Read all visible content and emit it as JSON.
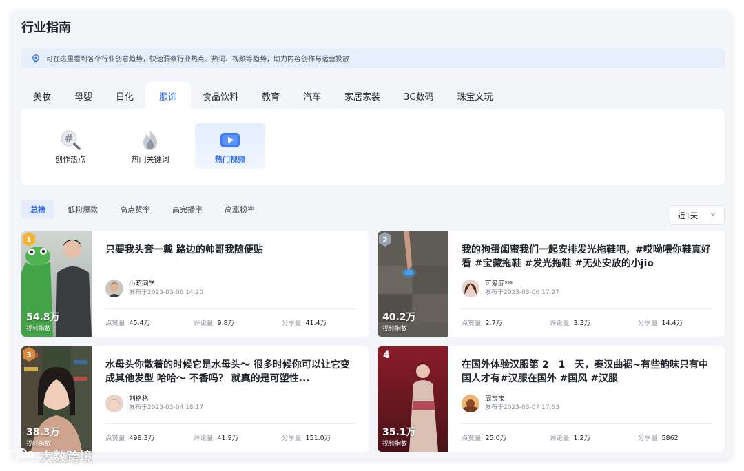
{
  "page": {
    "title": "行业指南"
  },
  "tip": {
    "icon": "lightbulb-icon",
    "text": "可在这里看到各个行业创意趋势，快速洞察行业热点、热词、视频等趋势，助力内容创作与运营投放"
  },
  "categories": [
    "美妆",
    "母婴",
    "日化",
    "服饰",
    "食品饮料",
    "教育",
    "汽车",
    "家居家装",
    "3C数码",
    "珠宝文玩"
  ],
  "active_category": "服饰",
  "sub_nav": [
    {
      "label": "创作热点",
      "icon": "hashtag-search-icon"
    },
    {
      "label": "热门关键词",
      "icon": "flame-icon"
    },
    {
      "label": "热门视频",
      "icon": "video-play-icon"
    }
  ],
  "active_sub_nav": "热门视频",
  "rank_tabs": [
    "总榜",
    "低粉爆款",
    "高点赞率",
    "高完播率",
    "高涨粉率"
  ],
  "active_rank_tab": "总榜",
  "time_range": {
    "selected": "近1天",
    "icon": "chevron-down-icon"
  },
  "stat_labels": {
    "index": "视频指数",
    "likes": "点赞量",
    "comments": "评论量",
    "shares": "分享量"
  },
  "videos": [
    {
      "rank": "1",
      "index_value": "54.8万",
      "title": "只要我头套一戴 路边的帅哥我随便贴",
      "author": "小昭同学",
      "published": "发布于2023-03-06 14:20",
      "likes": "45.4万",
      "comments": "9.8万",
      "shares": "41.4万"
    },
    {
      "rank": "2",
      "index_value": "40.2万",
      "title": "我的狗蛋闺蜜我们一起安排发光拖鞋吧，#哎呦喂你鞋真好看 #宝藏拖鞋 #发光拖鞋 #无处安放的小jio",
      "author": "可爱屁⁹⁹⁹",
      "published": "发布于2023-03-06 17:27",
      "likes": "2.7万",
      "comments": "3.3万",
      "shares": "14.4万"
    },
    {
      "rank": "3",
      "index_value": "38.3万",
      "title": "水母头你散着的时候它是水母头～ 很多时候你可以让它变成其他发型 哈哈～ 不香吗？ 就真的是可塑性...",
      "author": "刘格格",
      "published": "发布于2023-03-04 18:17",
      "likes": "498.3万",
      "comments": "41.9万",
      "shares": "151.0万"
    },
    {
      "rank": "4",
      "index_value": "35.1万",
      "title": "在国外体验汉服第 2　1　天，秦汉曲裾~有些韵味只有中国人才有#汉服在国外 #国风 #汉服",
      "author": "周宝宝",
      "published": "发布于2023-03-07 17:53",
      "likes": "25.0万",
      "comments": "1.2万",
      "shares": "5862"
    }
  ],
  "watermark": {
    "text": "大数跨境",
    "icon": "brand-logo-icon"
  },
  "colors": {
    "accent": "#2d6bf6",
    "gold": "#f2b233",
    "silver": "#9aa3ad",
    "bronze": "#d8893a"
  }
}
